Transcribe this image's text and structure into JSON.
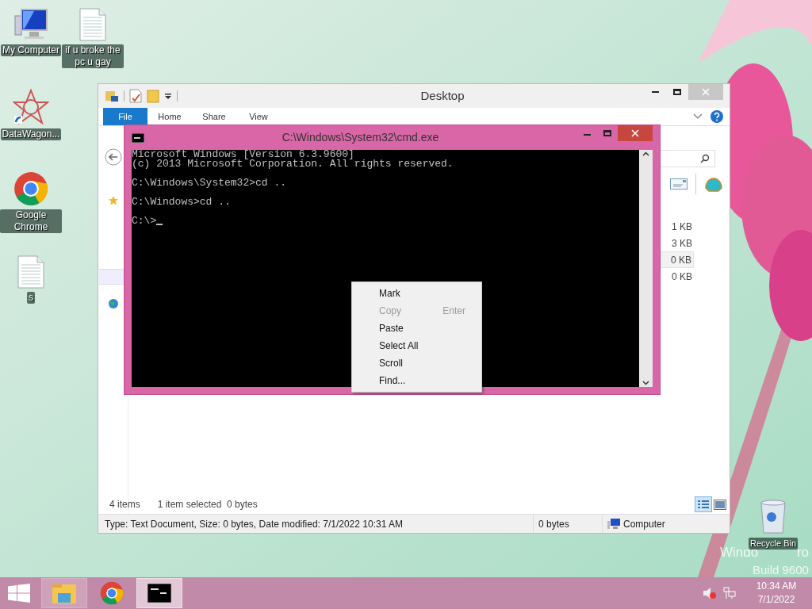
{
  "desktop_icons": [
    {
      "label": "My Computer",
      "kind": "computer"
    },
    {
      "label": "if u broke the pc u gay",
      "kind": "document"
    },
    {
      "label": "DataWagon...",
      "kind": "shortcut"
    },
    {
      "label": "Google Chrome",
      "kind": "chrome"
    },
    {
      "label": "s",
      "kind": "document"
    },
    {
      "label": "Recycle Bin",
      "kind": "recycle"
    }
  ],
  "watermark": {
    "edition_parts": [
      "Windo",
      "ro"
    ],
    "build": "Build 9600"
  },
  "explorer": {
    "title": "Desktop",
    "ribbon_tabs": [
      {
        "label": "File",
        "selected": true
      },
      {
        "label": "Home",
        "selected": false
      },
      {
        "label": "Share",
        "selected": false
      },
      {
        "label": "View",
        "selected": false
      }
    ],
    "file_sizes": [
      {
        "size": "1 KB",
        "selected": false
      },
      {
        "size": "3 KB",
        "selected": false
      },
      {
        "size": "0 KB",
        "selected": true
      },
      {
        "size": "0 KB",
        "selected": false
      }
    ],
    "item_count": "4 items",
    "selection_info": "1 item selected  0 bytes",
    "details": {
      "info": "Type: Text Document, Size: 0 bytes, Date modified: 7/1/2022 10:31 AM",
      "size": "0 bytes",
      "location": "Computer"
    }
  },
  "cmd": {
    "title": "C:\\Windows\\System32\\cmd.exe",
    "blocks": [
      [
        "Microsoft Windows [Version 6.3.9600]",
        "(c) 2013 Microsoft Corporation. All rights reserved."
      ],
      [
        "C:\\Windows\\System32>cd .."
      ],
      [
        "C:\\Windows>cd .."
      ],
      [
        "C:\\>"
      ]
    ]
  },
  "context_menu": [
    {
      "label": "Mark",
      "disabled": false
    },
    {
      "label": "Copy",
      "shortcut": "Enter",
      "disabled": true
    },
    {
      "label": "Paste",
      "disabled": false
    },
    {
      "label": "Select All",
      "disabled": false
    },
    {
      "label": "Scroll",
      "disabled": false
    },
    {
      "label": "Find...",
      "disabled": false
    }
  ],
  "taskbar": {
    "items": [
      {
        "kind": "explorer",
        "selected": false
      },
      {
        "kind": "chrome",
        "selected": false
      },
      {
        "kind": "console",
        "selected": true
      }
    ],
    "time": "10:34 AM",
    "date": "7/1/2022"
  }
}
